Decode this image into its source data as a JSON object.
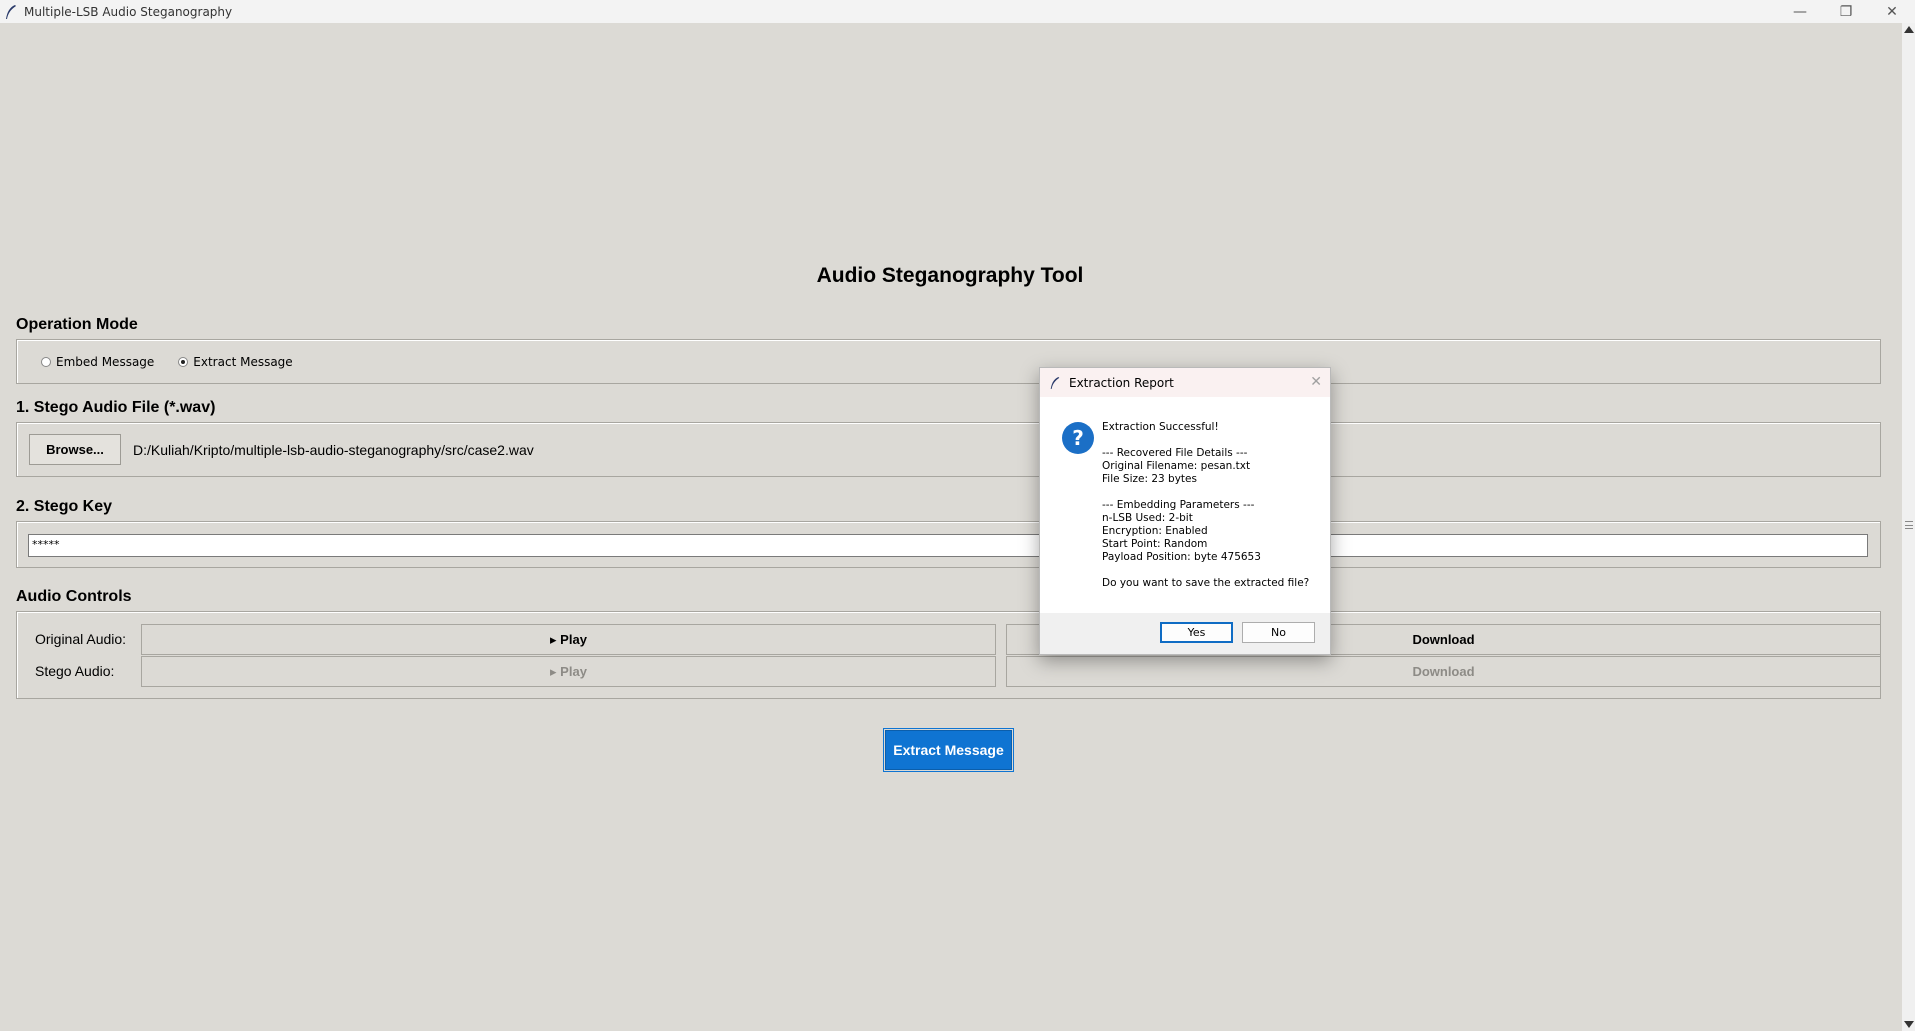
{
  "window": {
    "title": "Multiple-LSB Audio Steganography",
    "minimize": "—",
    "maximize": "❐",
    "close": "✕"
  },
  "main": {
    "heading": "Audio Steganography Tool",
    "operation_mode": {
      "label": "Operation Mode",
      "options": [
        "Embed Message",
        "Extract Message"
      ],
      "selected": "Extract Message"
    },
    "stego_file": {
      "label": "1. Stego Audio File (*.wav)",
      "browse_label": "Browse...",
      "path": "D:/Kuliah/Kripto/multiple-lsb-audio-steganography/src/case2.wav"
    },
    "stego_key": {
      "label": "2. Stego Key",
      "value": "*****"
    },
    "audio_controls": {
      "label": "Audio Controls",
      "original_label": "Original Audio:",
      "stego_label": "Stego Audio:",
      "play_label": "▸ Play",
      "download_label": "Download"
    },
    "action_button": "Extract Message"
  },
  "dialog": {
    "title": "Extraction Report",
    "icon": "question-icon",
    "body": "Extraction Successful!\n\n--- Recovered File Details ---\nOriginal Filename: pesan.txt\nFile Size: 23 bytes\n\n--- Embedding Parameters ---\nn-LSB Used: 2-bit\nEncryption: Enabled\nStart Point: Random\nPayload Position: byte 475653\n\nDo you want to save the extracted file?",
    "yes_label": "Yes",
    "no_label": "No"
  },
  "colors": {
    "background": "#dcdad5",
    "accent": "#0f74d2"
  }
}
